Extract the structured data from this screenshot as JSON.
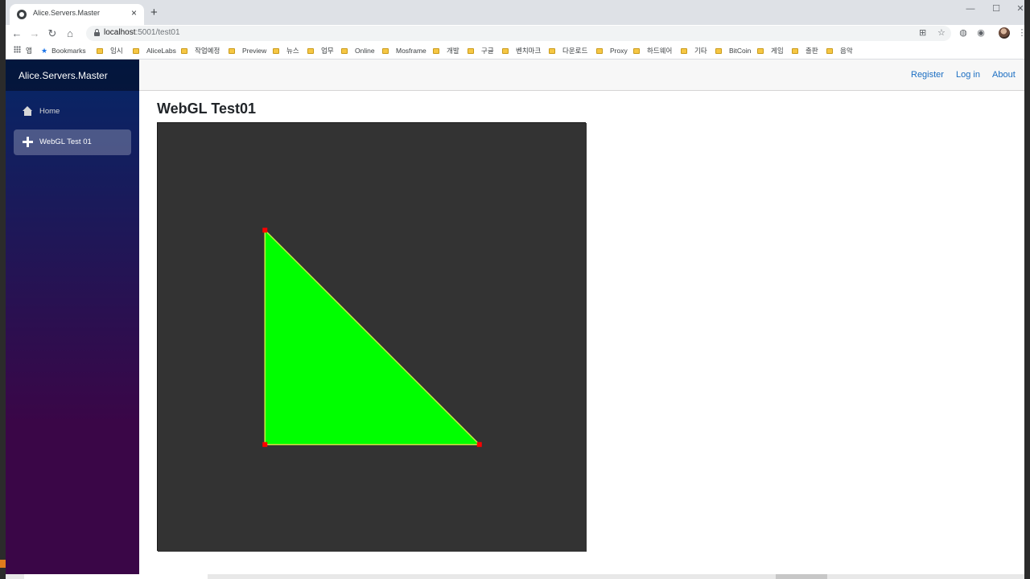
{
  "browser": {
    "tab_title": "Alice.Servers.Master",
    "tab_close": "×",
    "new_tab": "+",
    "url_host": "localhost",
    "url_path": ":5001/test01",
    "window_minimize": "—",
    "window_maximize": "☐",
    "window_close": "✕",
    "bookmarks": [
      "앱",
      "Bookmarks",
      "임시",
      "AliceLabs",
      "작업예정",
      "Preview",
      "뉴스",
      "업무",
      "Online",
      "Mosframe",
      "개발",
      "구글",
      "벤치마크",
      "다운로드",
      "Proxy",
      "하드웨어",
      "기타",
      "BitCoin",
      "게임",
      "출판",
      "음악"
    ]
  },
  "sidebar": {
    "brand": "Alice.Servers.Master",
    "items": [
      {
        "label": "Home",
        "icon": "home-icon",
        "active": false
      },
      {
        "label": "WebGL Test 01",
        "icon": "plus-icon",
        "active": true
      }
    ]
  },
  "topbar": {
    "links": [
      "Register",
      "Log in",
      "About"
    ]
  },
  "main": {
    "title": "WebGL Test01"
  },
  "webgl": {
    "clear_color": "#333333",
    "fill_color": "#00ff00",
    "edge_color": "#c8f040",
    "vertex_color": "#ff0000",
    "vertices_clip": [
      [
        -0.5,
        0.5
      ],
      [
        -0.5,
        -0.5
      ],
      [
        0.5,
        -0.5
      ]
    ]
  }
}
